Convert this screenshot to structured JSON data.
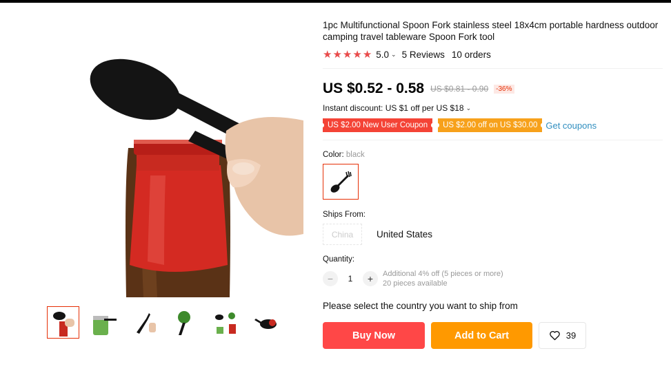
{
  "product": {
    "title": "1pc Multifunctional Spoon Fork stainless steel 18x4cm portable hardness outdoor camping travel tableware Spoon Fork tool",
    "rating_value": "5.0",
    "reviews_label": "5 Reviews",
    "orders_label": "10 orders",
    "price": "US $0.52 - 0.58",
    "old_price": "US $0.81 - 0.90",
    "discount_percent": "-36%",
    "instant_discount": "Instant discount: US $1 off per US $18"
  },
  "coupons": {
    "new_user": "US $2.00 New User Coupon",
    "off_coupon": "US $2.00 off on US $30.00",
    "get_coupons_link": "Get coupons"
  },
  "color": {
    "label": "Color:",
    "selected_value": "black"
  },
  "ships_from": {
    "label": "Ships From:",
    "options": [
      "China",
      "United States"
    ]
  },
  "quantity": {
    "label": "Quantity:",
    "value": "1",
    "minus_symbol": "−",
    "plus_symbol": "+",
    "additional_discount": "Additional 4% off (5 pieces or more)",
    "available": "20 pieces available"
  },
  "shipping_message": "Please select the country you want to ship from",
  "actions": {
    "buy_now": "Buy Now",
    "add_to_cart": "Add to Cart",
    "wishlist_count": "39"
  },
  "colors": {
    "accent_red": "#ff4747",
    "accent_orange": "#ff9900",
    "star_color": "#e94b4b",
    "link_blue": "#2f8ebf"
  },
  "icons": [
    "star-icon",
    "chevron-down-icon",
    "heart-icon"
  ]
}
